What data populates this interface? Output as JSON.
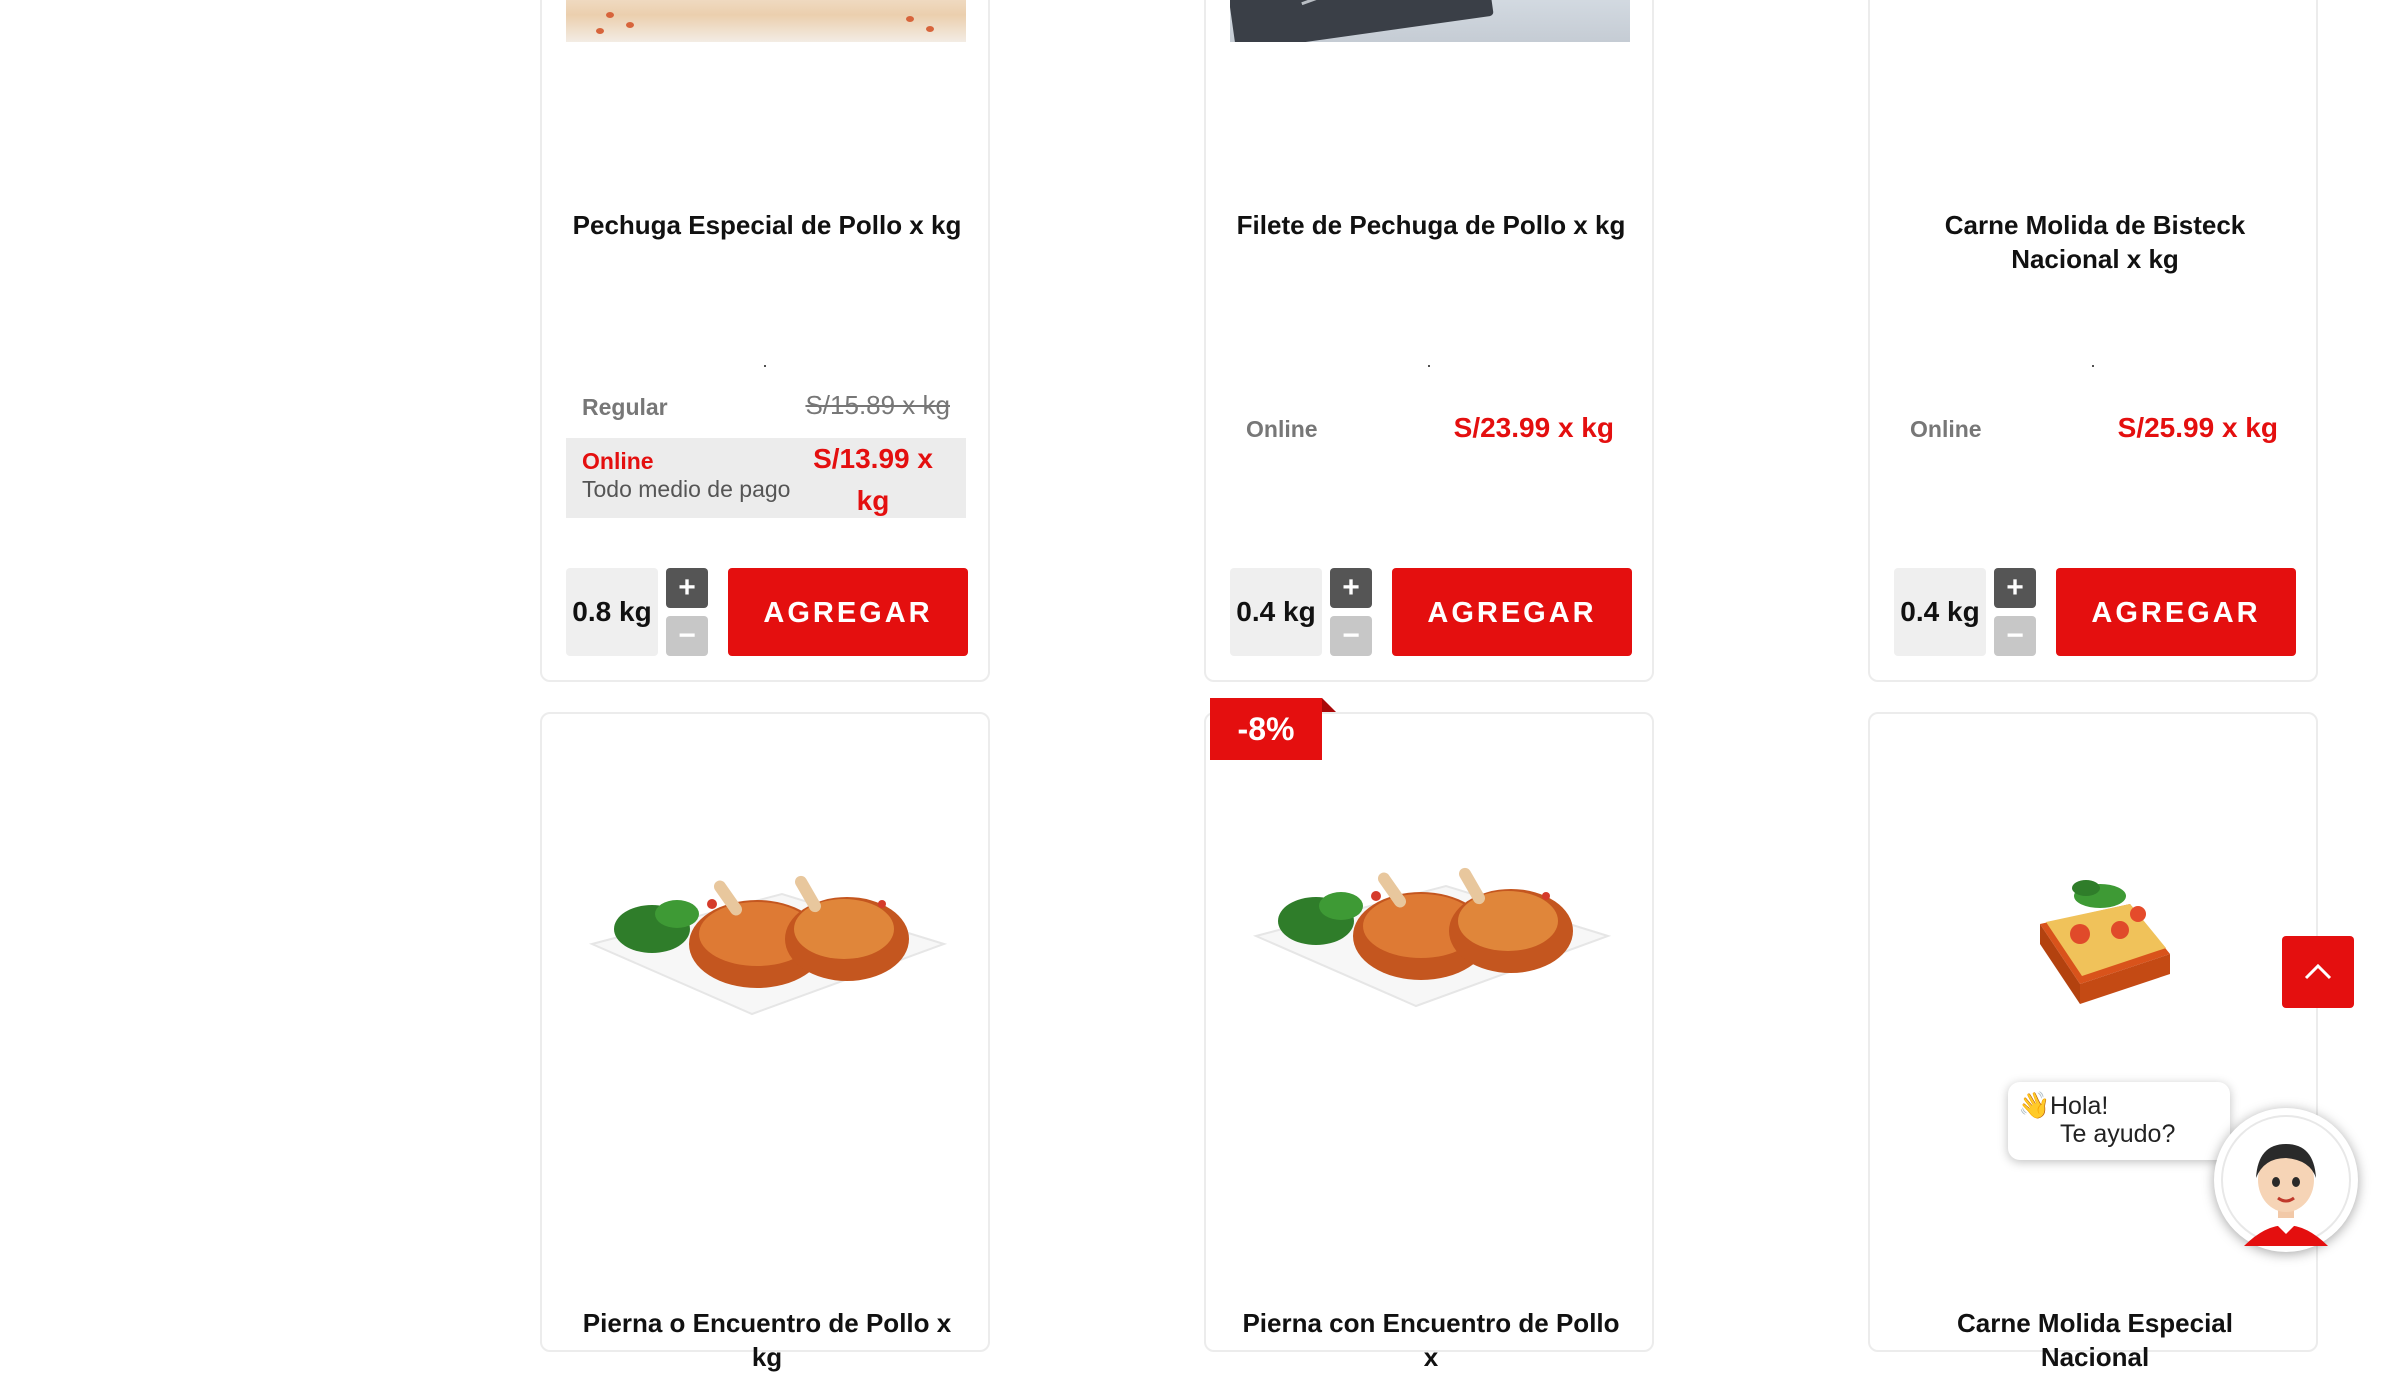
{
  "products_top": [
    {
      "name": "Pechuga Especial de Pollo x kg",
      "dot": ".",
      "regular_label": "Regular",
      "regular_price": "S/15.89 x kg",
      "online_label": "Online",
      "payment_label": "Todo medio de pago",
      "online_price": "S/13.99 x kg",
      "quantity": "0.8 kg",
      "plus": "+",
      "minus": "−",
      "add_label": "AGREGAR"
    },
    {
      "name": "Filete de Pechuga de Pollo x kg",
      "dot": ".",
      "online_label": "Online",
      "online_price": "S/23.99 x kg",
      "quantity": "0.4 kg",
      "plus": "+",
      "minus": "−",
      "add_label": "AGREGAR"
    },
    {
      "name": "Carne Molida de Bisteck Nacional x kg",
      "dot": ".",
      "online_label": "Online",
      "online_price": "S/25.99 x kg",
      "quantity": "0.4 kg",
      "plus": "+",
      "minus": "−",
      "add_label": "AGREGAR"
    }
  ],
  "products_bottom": [
    {
      "name": "Pierna o Encuentro de Pollo x kg"
    },
    {
      "name": "Pierna con Encuentro de Pollo x",
      "discount_badge": "-8%"
    },
    {
      "name": "Carne Molida Especial Nacional"
    }
  ],
  "chat_widget": {
    "greeting_icon": "👋",
    "line1": "Hola!",
    "line2": "Te ayudo?"
  },
  "icons": {
    "scroll_top": "chevron-up-icon",
    "chat": "assistant-avatar-icon"
  },
  "colors": {
    "accent": "#e40f0f",
    "muted_text": "#777777",
    "card_border": "#ececec"
  }
}
